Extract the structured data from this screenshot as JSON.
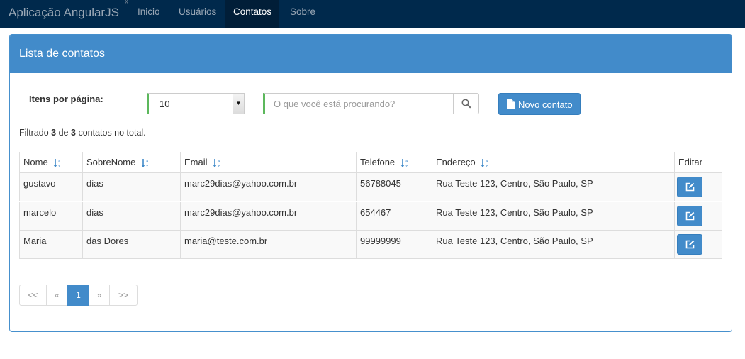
{
  "navbar": {
    "brand": "Aplicação AngularJS",
    "brand_mark": "x",
    "items": [
      {
        "label": "Inicio"
      },
      {
        "label": "Usuários"
      },
      {
        "label": "Contatos"
      },
      {
        "label": "Sobre"
      }
    ],
    "active": "Contatos"
  },
  "panel": {
    "title": "Lista de contatos"
  },
  "controls": {
    "itens_label": "Itens por página:",
    "itens_value": "10",
    "search_placeholder": "O que você está procurando?",
    "novo_label": "Novo contato"
  },
  "filter": {
    "prefix": "Filtrado",
    "shown": "3",
    "middle": "de",
    "total": "3",
    "suffix": "contatos no total."
  },
  "table": {
    "headers": [
      "Nome",
      "SobreNome",
      "Email",
      "Telefone",
      "Endereço",
      "Editar"
    ],
    "rows": [
      {
        "nome": "gustavo",
        "sobrenome": "dias",
        "email": "marc29dias@yahoo.com.br",
        "telefone": "56788045",
        "endereco": "Rua Teste 123, Centro, São Paulo, SP"
      },
      {
        "nome": "marcelo",
        "sobrenome": "dias",
        "email": "marc29dias@yahoo.com.br",
        "telefone": "654467",
        "endereco": "Rua Teste 123, Centro, São Paulo, SP"
      },
      {
        "nome": "Maria",
        "sobrenome": "das Dores",
        "email": "maria@teste.com.br",
        "telefone": "99999999",
        "endereco": "Rua Teste 123, Centro, São Paulo, SP"
      }
    ]
  },
  "pagination": {
    "first": "<<",
    "prev": "«",
    "current": "1",
    "next": "»",
    "last": ">>"
  },
  "colors": {
    "navbar_bg": "#00294c",
    "primary": "#428bca",
    "success_accent": "#5cb85c"
  },
  "icons": {
    "search": "search-icon",
    "new": "document-icon",
    "edit": "edit-icon",
    "sort": "sort-alpha-icon"
  }
}
